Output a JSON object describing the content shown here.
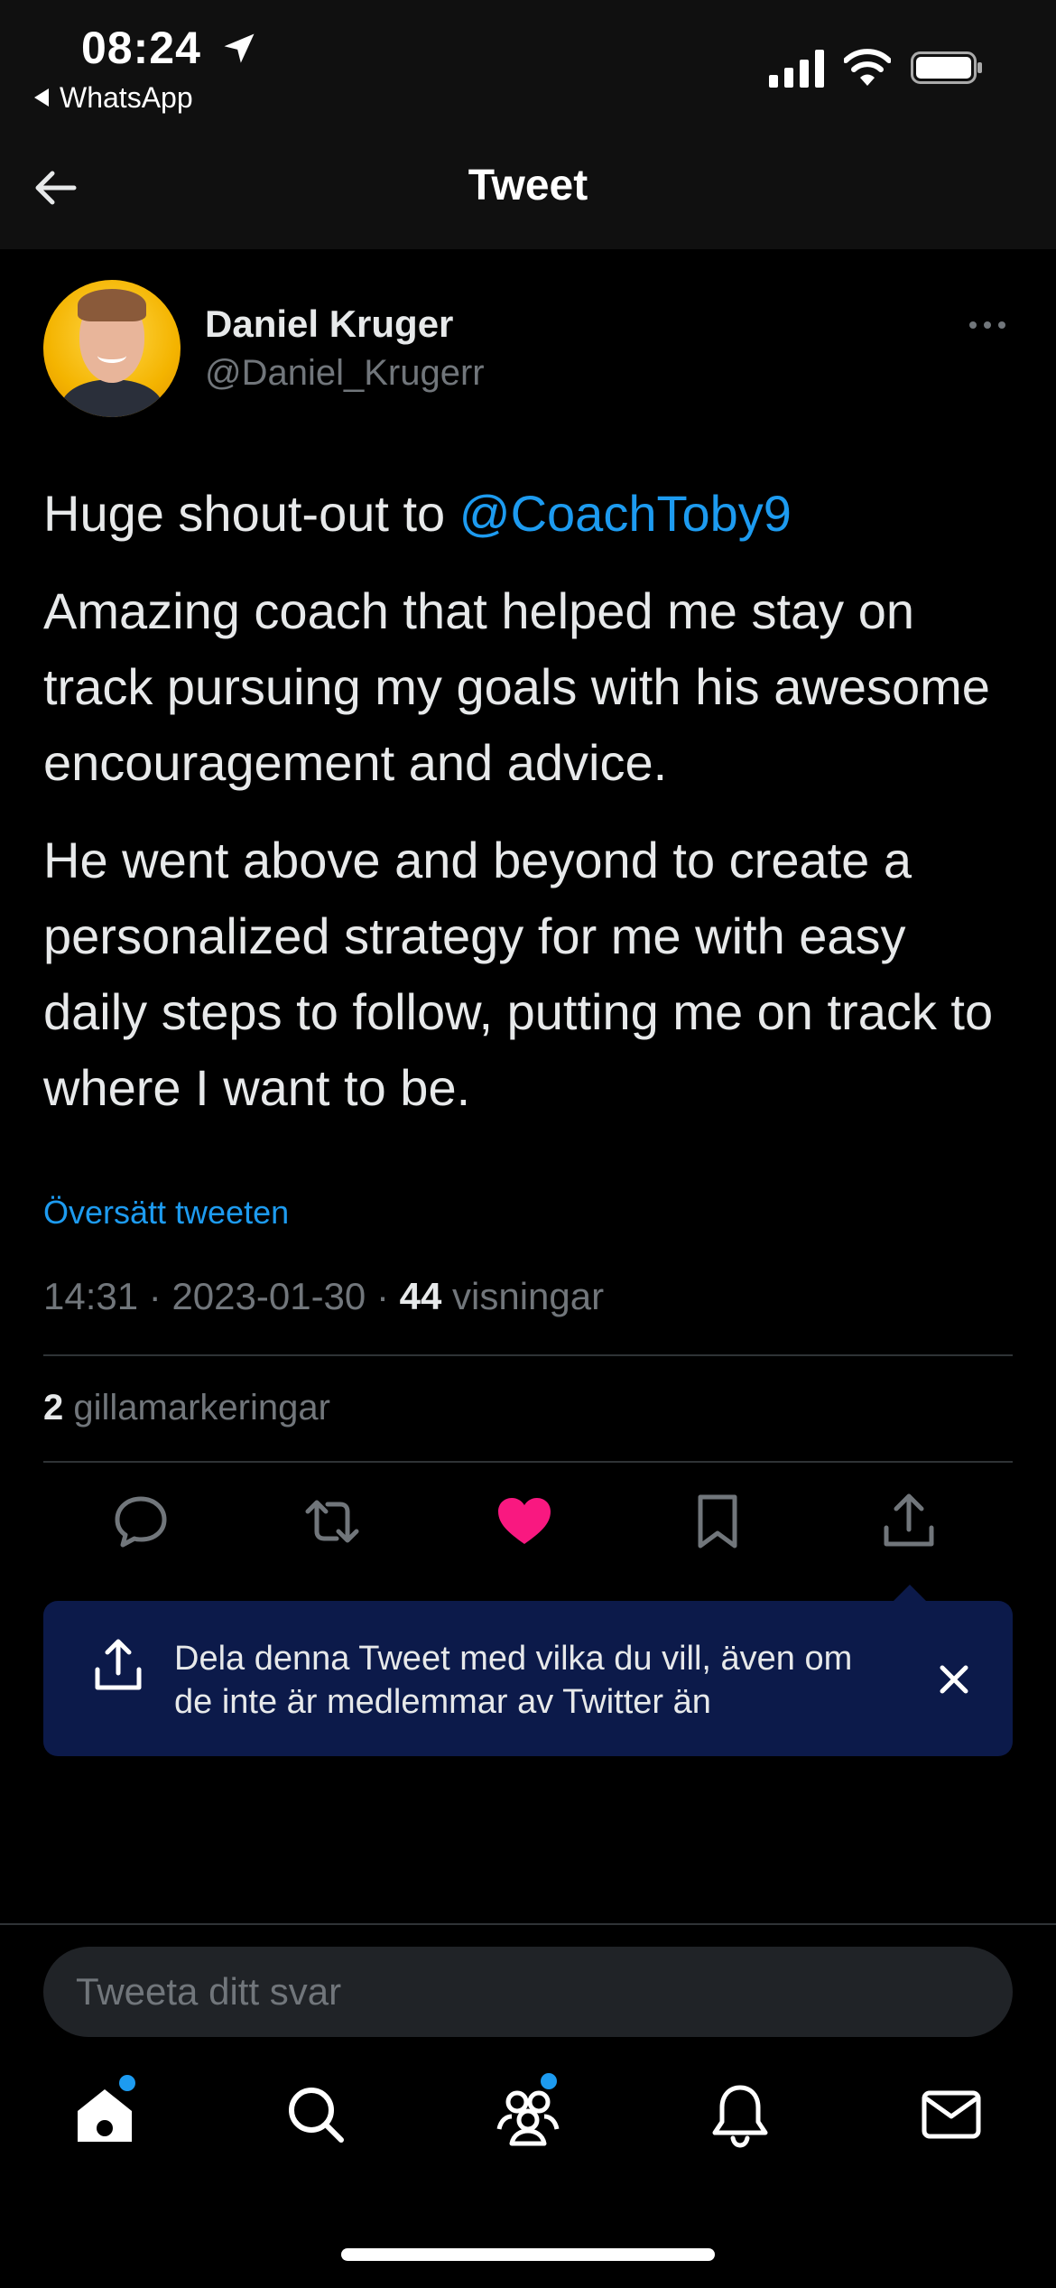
{
  "status_bar": {
    "time": "08:24",
    "back_app": "WhatsApp"
  },
  "header": {
    "title": "Tweet"
  },
  "tweet": {
    "author_name": "Daniel Kruger",
    "author_handle": "@Daniel_Krugerr",
    "p1_prefix": "Huge shout-out to ",
    "p1_mention": "@CoachToby9",
    "p2": "Amazing coach that helped me stay on track pursuing my goals with his awesome encouragement and advice.",
    "p3": "He went above and beyond to create a personalized strategy for me with easy daily steps to follow, putting me on track to where I want to be.",
    "translate_label": "Översätt tweeten",
    "time": "14:31",
    "date": "2023-01-30",
    "views_count": "44",
    "views_label": "visningar",
    "likes_count": "2",
    "likes_label": "gillamarkeringar"
  },
  "actions": {
    "icons": [
      "reply-icon",
      "retweet-icon",
      "like-icon",
      "bookmark-icon",
      "share-icon"
    ],
    "like_color": "#f91880"
  },
  "tooltip": {
    "text": "Dela denna Tweet med vilka du vill, även om de inte är medlemmar av Twitter än"
  },
  "reply": {
    "placeholder": "Tweeta ditt svar"
  },
  "tab_bar": {
    "icons": [
      "home-icon",
      "search-icon",
      "communities-icon",
      "notifications-icon",
      "messages-icon"
    ]
  },
  "colors": {
    "accent": "#1d9bf0",
    "background": "#000000",
    "tooltip_bg": "#0c1a4a"
  }
}
